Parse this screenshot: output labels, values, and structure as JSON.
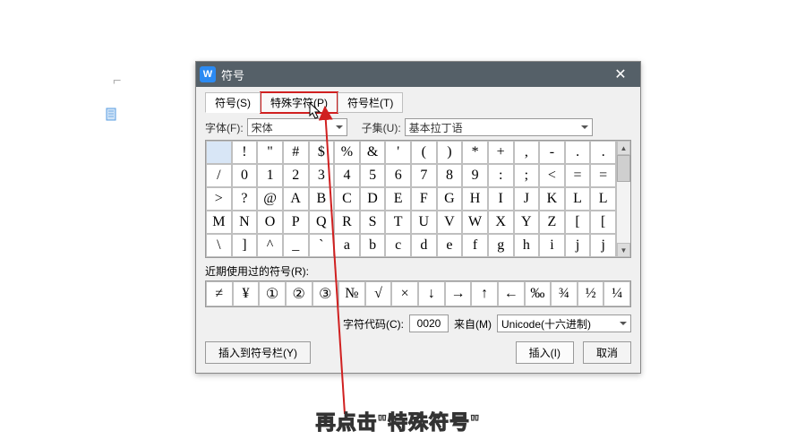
{
  "titlebar": {
    "title": "符号"
  },
  "tabs": [
    {
      "label": "符号(S)"
    },
    {
      "label": "特殊字符(P)"
    },
    {
      "label": "符号栏(T)"
    }
  ],
  "font": {
    "label": "字体(F):",
    "value": "宋体"
  },
  "subset": {
    "label": "子集(U):",
    "value": "基本拉丁语"
  },
  "chars": [
    [
      " ",
      "!",
      "\"",
      "#",
      "$",
      "%",
      "&",
      "'",
      "(",
      ")",
      "*",
      "+",
      ",",
      "-",
      ".",
      "."
    ],
    [
      "/",
      "0",
      "1",
      "2",
      "3",
      "4",
      "5",
      "6",
      "7",
      "8",
      "9",
      ":",
      ";",
      "<",
      "=",
      "="
    ],
    [
      ">",
      "?",
      "@",
      "A",
      "B",
      "C",
      "D",
      "E",
      "F",
      "G",
      "H",
      "I",
      "J",
      "K",
      "L",
      "L"
    ],
    [
      "M",
      "N",
      "O",
      "P",
      "Q",
      "R",
      "S",
      "T",
      "U",
      "V",
      "W",
      "X",
      "Y",
      "Z",
      "[",
      "["
    ],
    [
      "\\",
      "]",
      "^",
      "_",
      "`",
      "a",
      "b",
      "c",
      "d",
      "e",
      "f",
      "g",
      "h",
      "i",
      "j",
      "j"
    ]
  ],
  "recent": {
    "label": "近期使用过的符号(R):",
    "items": [
      "≠",
      "¥",
      "①",
      "②",
      "③",
      "№",
      "√",
      "×",
      "↓",
      "→",
      "↑",
      "←",
      "‰",
      "¾",
      "½",
      "¼"
    ]
  },
  "code": {
    "label": "字符代码(C):",
    "value": "0020"
  },
  "from": {
    "label": "来自(M)",
    "value": "Unicode(十六进制)"
  },
  "buttons": {
    "tobar": "插入到符号栏(Y)",
    "insert": "插入(I)",
    "cancel": "取消"
  },
  "caption": "再点击\"特殊符号\""
}
